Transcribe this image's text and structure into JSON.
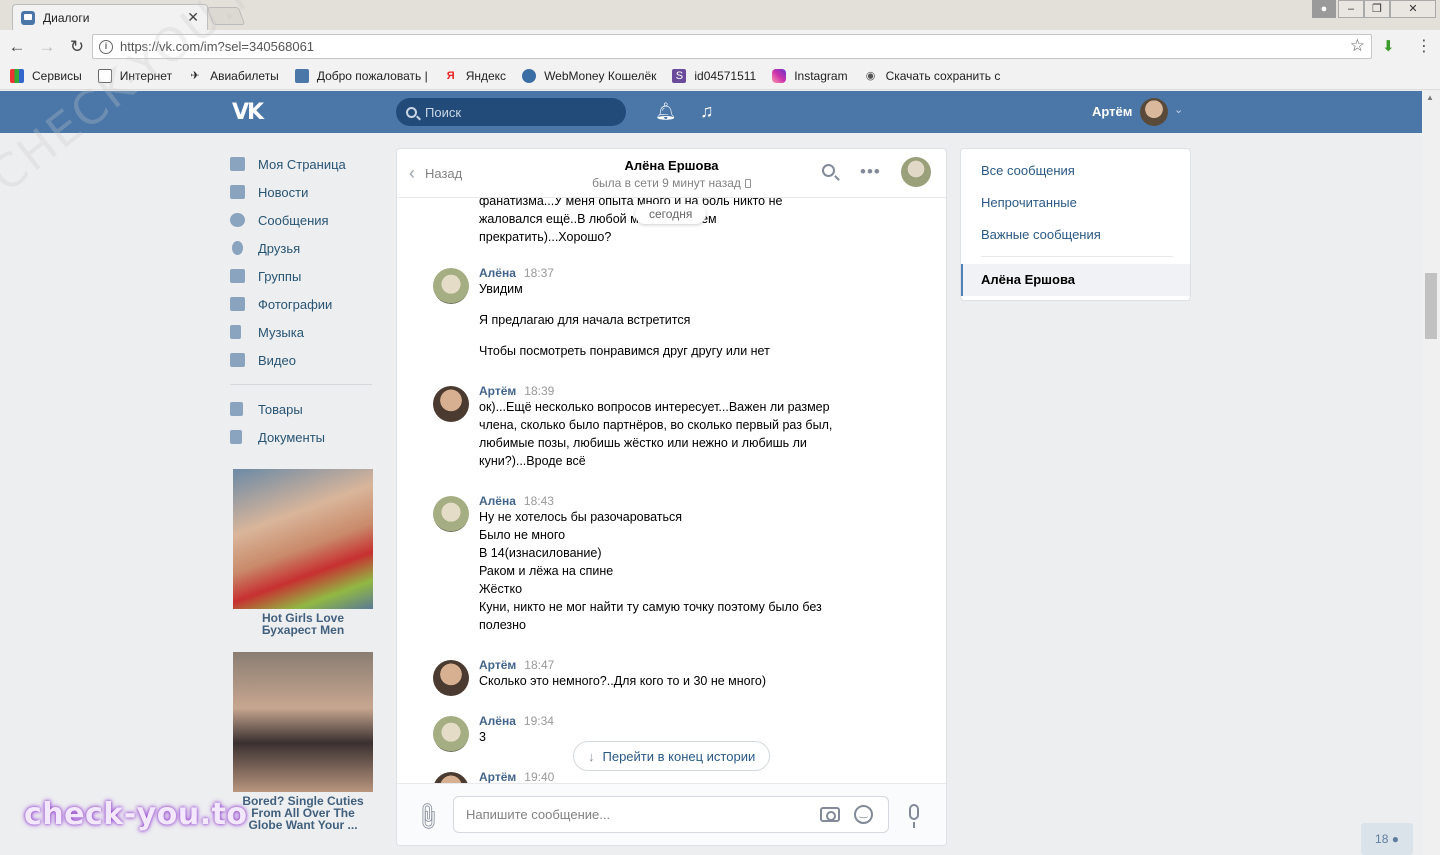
{
  "browser": {
    "tab_title": "Диалоги",
    "url": "https://vk.com/im?sel=340568061",
    "bookmarks": [
      "Сервисы",
      "Интернет",
      "Авиабилеты",
      "Добро пожаловать |",
      "Яндекс",
      "WebMoney Кошелёк",
      "id04571511",
      "Instagram",
      "Скачать сохранить с"
    ]
  },
  "header": {
    "search_placeholder": "Поиск",
    "user_name": "Артём"
  },
  "left_menu": {
    "items": [
      "Моя Страница",
      "Новости",
      "Сообщения",
      "Друзья",
      "Группы",
      "Фотографии",
      "Музыка",
      "Видео"
    ],
    "items2": [
      "Товары",
      "Документы"
    ]
  },
  "ads": [
    {
      "title": "Hot Girls Love Бухарест Men"
    },
    {
      "title": "Bored? Single Cuties From All Over The Globe Want Your ..."
    }
  ],
  "chat": {
    "back_label": "Назад",
    "peer_name": "Алёна Ершова",
    "peer_status": "была в сети 9 минут назад",
    "today_label": "сегодня",
    "top_lines": [
      "фанатизма...У меня опыта много и на боль никто не",
      "жаловался ещё..В любой момент можем",
      "прекратить)...Хорошо?"
    ],
    "groups": [
      {
        "author": "Алёна",
        "time": "18:37",
        "lines": [
          "Увидим",
          "",
          "Я предлагаю для начала встретится",
          "",
          "Чтобы посмотреть понравимся друг другу или нет"
        ]
      },
      {
        "author": "Артём",
        "time": "18:39",
        "lines": [
          "ок)...Ещё несколько вопросов интересует...Важен ли размер",
          "члена, сколько было партнёров, во сколько первый раз был,",
          "любимые позы, любишь жёстко или нежно и любишь ли",
          "куни?)...Вроде всё"
        ]
      },
      {
        "author": "Алёна",
        "time": "18:43",
        "lines": [
          "Ну не хотелось бы разочароваться",
          "Было не много",
          "В 14(изнасилование)",
          "Раком и лёжа на спине",
          "Жёстко",
          "Куни, никто не мог найти ту самую точку поэтому было без",
          "полезно"
        ]
      },
      {
        "author": "Артём",
        "time": "18:47",
        "lines": [
          "Сколько это немного?..Для кого то и 30 не много)"
        ]
      },
      {
        "author": "Алёна",
        "time": "19:34",
        "lines": [
          "3"
        ]
      },
      {
        "author": "Артём",
        "time": "19:40",
        "lines": []
      }
    ],
    "jump_label": "Перейти в конец истории",
    "composer_placeholder": "Напишите сообщение..."
  },
  "right_panel": {
    "all": "Все сообщения",
    "unread": "Непрочитанные",
    "important": "Важные сообщения",
    "active": "Алёна Ершова"
  },
  "counter": "18",
  "watermark": "check-you.to",
  "watermark_diag": "CHECK-YOU.ME"
}
